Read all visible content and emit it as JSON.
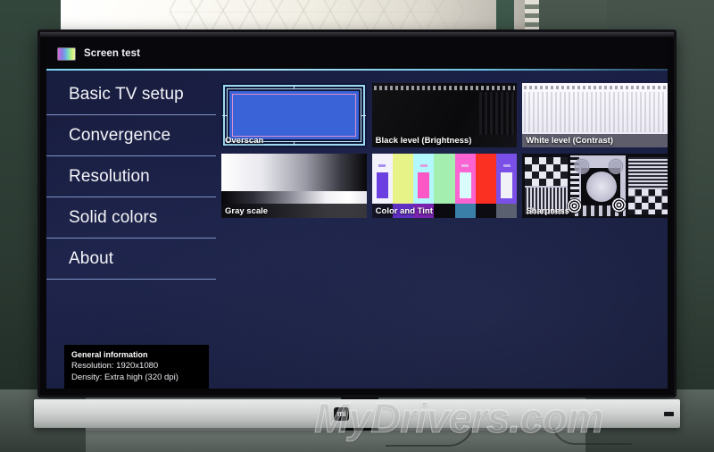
{
  "app": {
    "title": "Screen test",
    "icon": "color-bars-icon"
  },
  "sidebar": {
    "items": [
      {
        "label": "Basic TV setup"
      },
      {
        "label": "Convergence"
      },
      {
        "label": "Resolution"
      },
      {
        "label": "Solid colors"
      },
      {
        "label": "About"
      }
    ]
  },
  "info": {
    "title": "General information",
    "resolution": "Resolution: 1920x1080",
    "density": "Density: Extra high (320 dpi)"
  },
  "tests": {
    "row1": [
      {
        "label": "Overscan",
        "pattern": "overscan"
      },
      {
        "label": "Black level (Brightness)",
        "pattern": "black-level"
      },
      {
        "label": "White level (Contrast)",
        "pattern": "white-level"
      }
    ],
    "row2": [
      {
        "label": "Gray scale",
        "pattern": "gray-scale"
      },
      {
        "label": "Color and Tint",
        "pattern": "color-bars"
      },
      {
        "label": "Sharpness",
        "pattern": "resolution-chart"
      }
    ]
  },
  "color_bars": {
    "bars": [
      "#f3f1fb",
      "#e8f387",
      "#b2f7fb",
      "#a4eeb0",
      "#fb63d2",
      "#fb2f22",
      "#7a4fe8"
    ],
    "inners": [
      "#6b3fe0",
      "",
      "#fb58c6",
      "",
      "#d9fbfb",
      "",
      "#f1f1f8"
    ],
    "footer": [
      "#141425",
      "#5f2fc4",
      "#7a22b0",
      "#0a0a10",
      "#3a7fa8",
      "#0c0c12",
      "#5b6070"
    ]
  },
  "device": {
    "brand_logo": "mi",
    "ir_sensor": "ir-sensor"
  },
  "watermark": {
    "text": "MyDrivers.com"
  },
  "accent_color": "#7fd4f0",
  "screen_bg": "#1a2046"
}
